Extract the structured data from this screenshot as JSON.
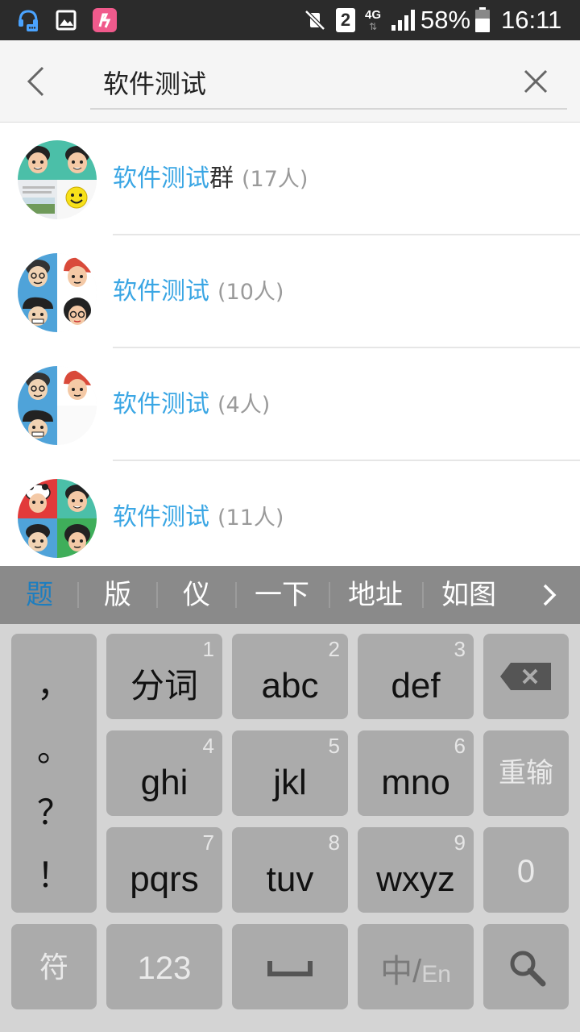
{
  "status_bar": {
    "sim_badge": "2",
    "network_type": "4G",
    "battery_percent": "58%",
    "time": "16:11"
  },
  "search": {
    "query": "软件测试"
  },
  "results": [
    {
      "name_highlight": "软件测试",
      "name_rest": "群",
      "count": "(17人)"
    },
    {
      "name_highlight": "软件测试",
      "name_rest": "",
      "count": "(10人)"
    },
    {
      "name_highlight": "软件测试",
      "name_rest": "",
      "count": "(4人)"
    },
    {
      "name_highlight": "软件测试",
      "name_rest": "",
      "count": "(11人)"
    }
  ],
  "candidates": [
    "题",
    "版",
    "仪",
    "一下",
    "地址",
    "如图"
  ],
  "keyboard": {
    "punctuation": [
      "，",
      "。",
      "？",
      "！"
    ],
    "keys": [
      {
        "label": "分词",
        "num": "1"
      },
      {
        "label": "abc",
        "num": "2"
      },
      {
        "label": "def",
        "num": "3"
      },
      {
        "label": "ghi",
        "num": "4"
      },
      {
        "label": "jkl",
        "num": "5"
      },
      {
        "label": "mno",
        "num": "6"
      },
      {
        "label": "pqrs",
        "num": "7"
      },
      {
        "label": "tuv",
        "num": "8"
      },
      {
        "label": "wxyz",
        "num": "9"
      }
    ],
    "reinput": "重输",
    "zero": "0",
    "symbols": "符",
    "numbers": "123",
    "lang_cn": "中",
    "lang_slash": "/",
    "lang_en": "En"
  },
  "colors": {
    "highlight": "#3aa6e4",
    "selected_candidate": "#1e7ebf",
    "status_bar": "#2b2b2b",
    "suggestion_bar": "#8a8a8a",
    "key": "#ababab",
    "keyboard_bg": "#d4d4d4"
  }
}
